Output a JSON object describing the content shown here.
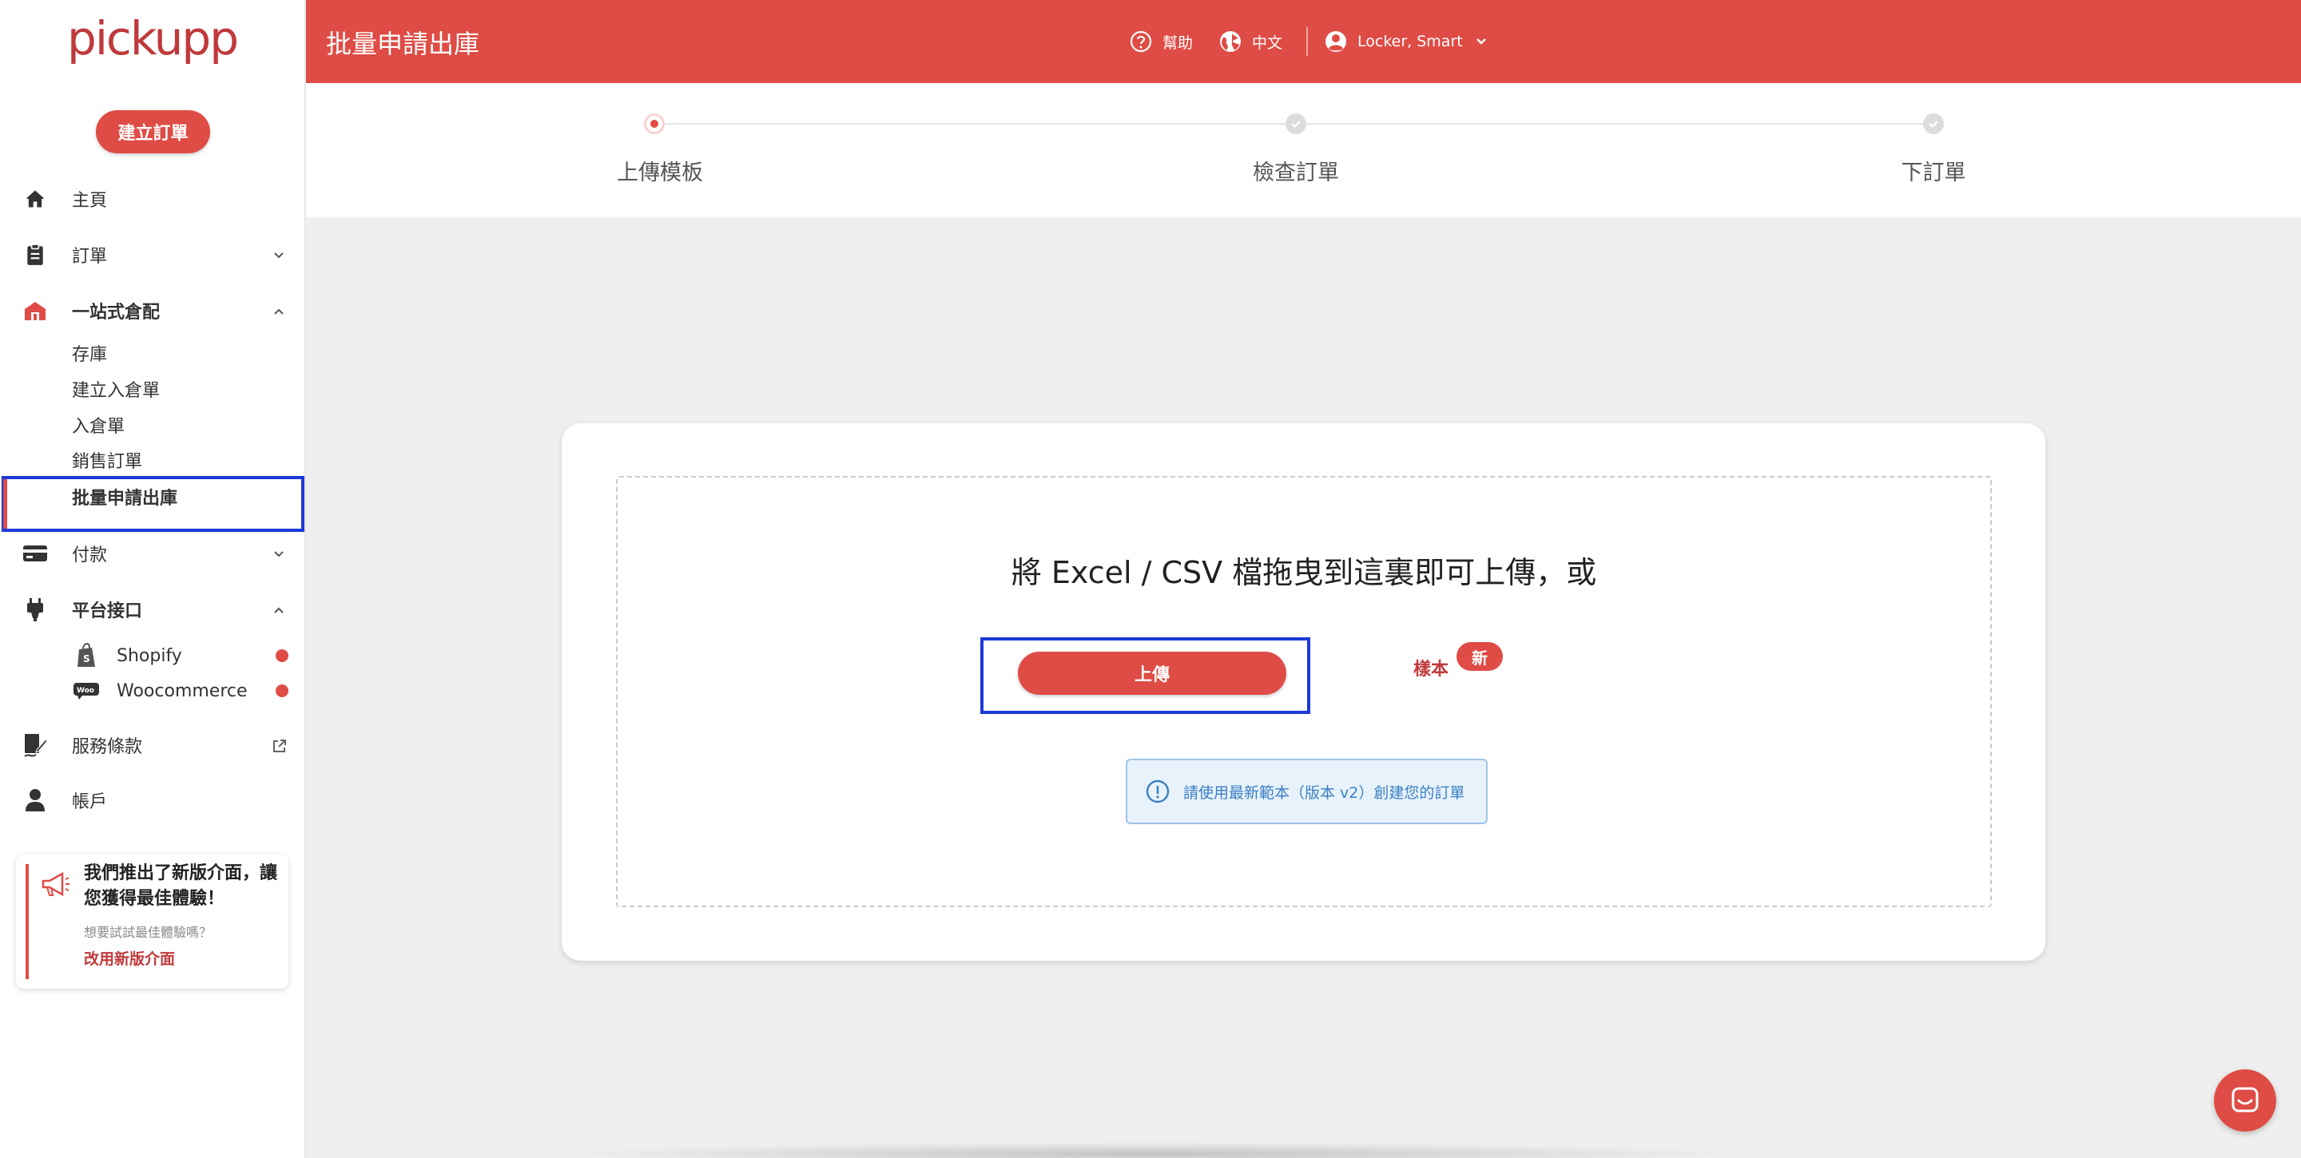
{
  "app": {
    "logo_text": "pickupp",
    "create_order_label": "建立訂單"
  },
  "header": {
    "title": "批量申請出庫",
    "help_label": "幫助",
    "language_label": "中文",
    "account_label": "Locker, Smart",
    "color": "#de4c45"
  },
  "sidebar": {
    "items": [
      {
        "label": "主頁",
        "icon": "home-icon"
      },
      {
        "label": "訂單",
        "icon": "clipboard-icon"
      },
      {
        "label": "一站式倉配",
        "icon": "warehouse-icon"
      },
      {
        "label": "付款",
        "icon": "credit-card-icon"
      },
      {
        "label": "平台接口",
        "icon": "plug-icon"
      },
      {
        "label": "服務條款",
        "icon": "signature-icon"
      },
      {
        "label": "帳戶",
        "icon": "user-icon"
      }
    ],
    "warehouse_sub": [
      "存庫",
      "建立入倉單",
      "入倉單",
      "銷售訂單",
      "批量申請出庫"
    ],
    "platforms": [
      {
        "label": "Shopify",
        "icon": "shopify-icon"
      },
      {
        "label": "Woocommerce",
        "icon": "woocommerce-icon"
      }
    ]
  },
  "promo": {
    "title": "我們推出了新版介面，讓您獲得最佳體驗！",
    "subtitle": "想要試試最佳體驗嗎？",
    "link": "改用新版介面"
  },
  "stepper": {
    "steps": [
      {
        "label": "上傳模板",
        "state": "active"
      },
      {
        "label": "檢查訂單",
        "state": "done"
      },
      {
        "label": "下訂單",
        "state": "done"
      }
    ]
  },
  "upload": {
    "drop_text": "將 Excel / CSV 檔拖曳到這裏即可上傳，或",
    "upload_label": "上傳",
    "sample_label": "樣本",
    "new_badge": "新",
    "info_text": "請使用最新範本（版本 v2）創建您的訂單"
  }
}
